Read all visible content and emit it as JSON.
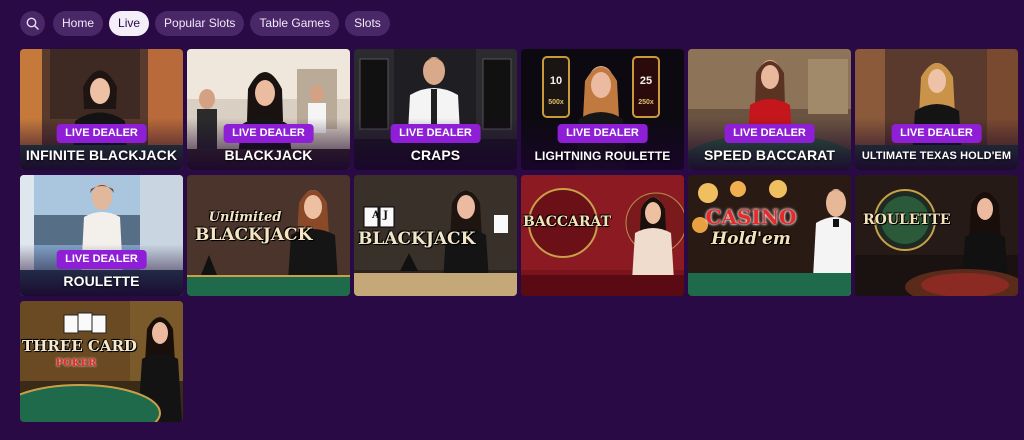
{
  "nav": {
    "search_icon": "search-icon",
    "tabs": [
      {
        "label": "Home",
        "active": false
      },
      {
        "label": "Live",
        "active": true
      },
      {
        "label": "Popular Slots",
        "active": false
      },
      {
        "label": "Table Games",
        "active": false
      },
      {
        "label": "Slots",
        "active": false
      }
    ]
  },
  "tiles": [
    {
      "badge": "LIVE DEALER",
      "title": "INFINITE BLACKJACK"
    },
    {
      "badge": "LIVE DEALER",
      "title": "BLACKJACK"
    },
    {
      "badge": "LIVE DEALER",
      "title": "CRAPS"
    },
    {
      "badge": "LIVE DEALER",
      "title": "LIGHTNING ROULETTE",
      "multipliers": [
        "10",
        "500x",
        "25",
        "250x"
      ]
    },
    {
      "badge": "LIVE DEALER",
      "title": "SPEED BACCARAT"
    },
    {
      "badge": "LIVE DEALER",
      "title": "ULTIMATE TEXAS HOLD'EM"
    },
    {
      "badge": "LIVE DEALER",
      "title": "ROULETTE"
    },
    {
      "logo_top": "Unlimited",
      "logo_bottom": "BLACKJACK"
    },
    {
      "logo_cards": "A J",
      "logo_bottom": "BLACKJACK"
    },
    {
      "logo_bottom": "BACCARAT"
    },
    {
      "logo_top": "CASINO",
      "logo_bottom": "Hold'em"
    },
    {
      "logo_bottom": "ROULETTE"
    },
    {
      "logo_top": "THREE CARD",
      "logo_bottom": "POKER"
    }
  ],
  "colors": {
    "page_bg": "#2a0a45",
    "pill_bg": "#4a2766",
    "pill_active_bg": "#f4eef9",
    "badge_bg": "#8e1fd6",
    "felt_green": "#1f6a4a"
  }
}
